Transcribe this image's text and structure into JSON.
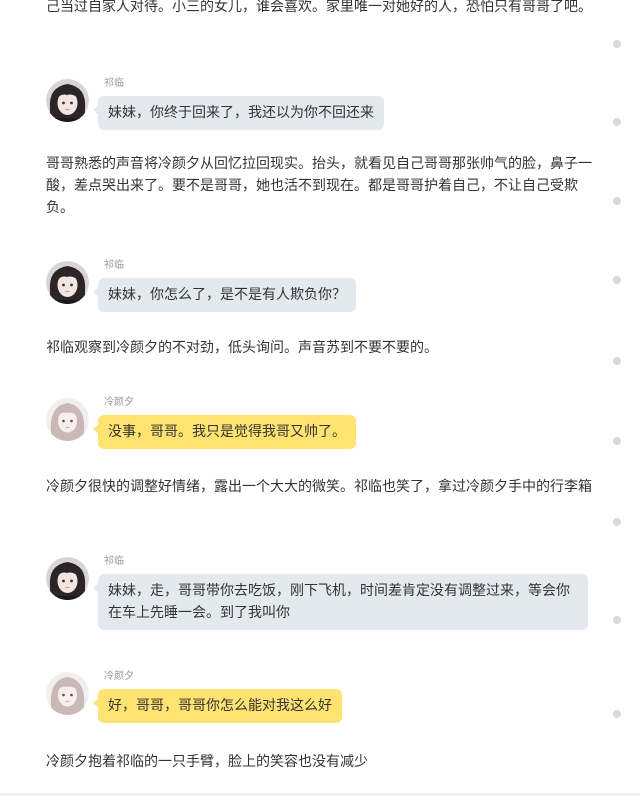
{
  "narration": {
    "p1": "己当过自家人对待。小三的女儿，谁会喜欢。家里唯一对她好的人，恐怕只有哥哥了吧。",
    "p2": "哥哥熟悉的声音将冷颜夕从回忆拉回现实。抬头，就看见自己哥哥那张帅气的脸，鼻子一酸，差点哭出来了。要不是哥哥，她也活不到现在。都是哥哥护着自己，不让自己受欺负。",
    "p3": "祁临观察到冷颜夕的不对劲，低头询问。声音苏到不要不要的。",
    "p4": "冷颜夕很快的调整好情绪，露出一个大大的微笑。祁临也笑了，拿过冷颜夕手中的行李箱",
    "p5": "冷颜夕抱着祁临的一只手臂，脸上的笑容也没有减少"
  },
  "characters": {
    "male": {
      "name": "祁临",
      "avatar_icon": "dark-hair-avatar-icon",
      "bubble_color": "#e4e9ef"
    },
    "female": {
      "name": "冷颜夕",
      "avatar_icon": "light-hair-avatar-icon",
      "bubble_color": "#ffe371"
    }
  },
  "messages": {
    "m1": {
      "speaker": "祁临",
      "text": "妹妹，你终于回来了，我还以为你不回还来"
    },
    "m2": {
      "speaker": "祁临",
      "text": "妹妹，你怎么了，是不是有人欺负你？"
    },
    "m3": {
      "speaker": "冷颜夕",
      "text": "没事，哥哥。我只是觉得我哥又帅了。"
    },
    "m4": {
      "speaker": "祁临",
      "text": "妹妹，走，哥哥带你去吃饭，刚下飞机，时间差肯定没有调整过来，等会你在车上先睡一会。到了我叫你"
    },
    "m5": {
      "speaker": "冷颜夕",
      "text": "好，哥哥，哥哥你怎么能对我这么好"
    }
  },
  "scroll_dots_icon": "dot-icon"
}
